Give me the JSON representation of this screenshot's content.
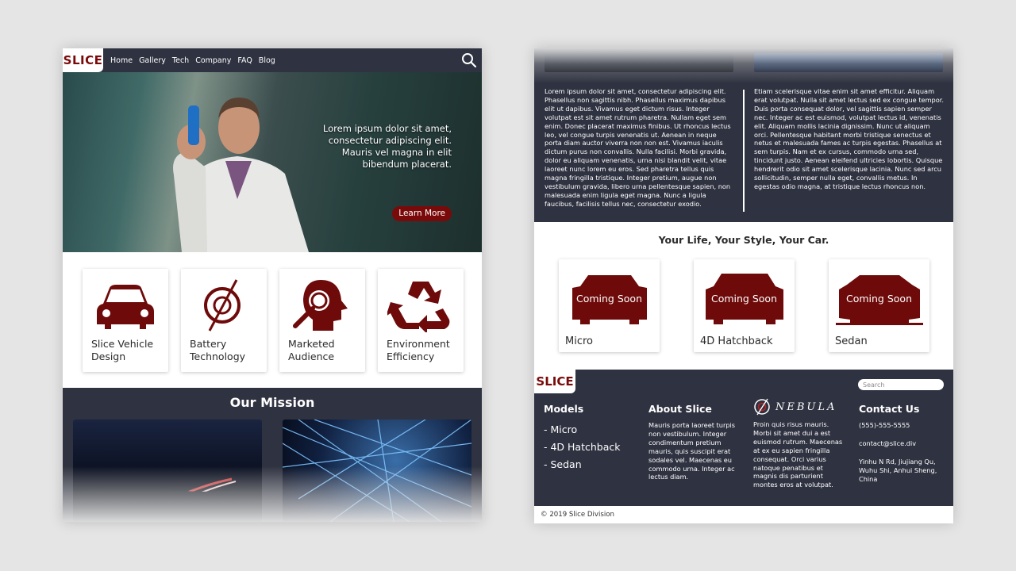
{
  "left": {
    "brand": "SLICE",
    "nav": [
      "Home",
      "Gallery",
      "Tech",
      "Company",
      "FAQ",
      "Blog"
    ],
    "hero": {
      "text": "Lorem ipsum dolor sit amet, consectetur adipiscing elit. Mauris vel magna in elit bibendum placerat.",
      "button": "Learn More"
    },
    "features": [
      {
        "label": "Slice Vehicle Design",
        "icon": "car-icon"
      },
      {
        "label": "Battery Technology",
        "icon": "battery-icon"
      },
      {
        "label": "Marketed Audience",
        "icon": "audience-icon"
      },
      {
        "label": "Environment Efficiency",
        "icon": "recycle-icon"
      }
    ],
    "mission_title": "Our Mission"
  },
  "right": {
    "para_left": "Lorem ipsum dolor sit amet, consectetur adipiscing elit. Phasellus non sagittis nibh. Phasellus maximus dapibus elit ut dapibus. Vivamus eget dictum risus. Integer volutpat est sit amet rutrum pharetra. Nullam eget sem enim. Donec placerat maximus finibus. Ut rhoncus lectus leo, vel congue turpis venenatis ut. Aenean in neque porta diam auctor viverra non non est. Vivamus iaculis dictum purus non convallis. Nulla facilisi. Morbi gravida, dolor eu aliquam venenatis, urna nisi blandit velit, vitae laoreet nunc lorem eu eros. Sed pharetra tellus quis magna fringilla tristique. Integer pretium, augue non vestibulum gravida, libero urna pellentesque sapien, non malesuada enim ligula eget magna. Nunc a ligula faucibus, facilisis tellus nec, consectetur exodio.",
    "para_right": "Etiam scelerisque vitae enim sit amet efficitur. Aliquam erat volutpat. Nulla sit amet lectus sed ex congue tempor. Duis porta consequat dolor, vel sagittis sapien semper nec. Integer ac est euismod, volutpat lectus id, venenatis elit. Aliquam mollis lacinia dignissim. Nunc ut aliquam orci. Pellentesque habitant morbi tristique senectus et netus et malesuada fames ac turpis egestas. Phasellus at sem turpis. Nam et ex cursus, commodo urna sed, tincidunt justo. Aenean eleifend ultricies lobortis. Quisque hendrerit odio sit amet scelerisque lacinia. Nunc sed arcu sollicitudin, semper nulla eget, convallis metus. In egestas odio magna, at tristique lectus rhoncus non.",
    "tagline": "Your Life, Your Style, Your Car.",
    "models": [
      {
        "name": "Micro",
        "badge": "Coming Soon"
      },
      {
        "name": "4D Hatchback",
        "badge": "Coming Soon"
      },
      {
        "name": "Sedan",
        "badge": "Coming Soon"
      }
    ],
    "footer": {
      "brand": "SLICE",
      "search_placeholder": "Search",
      "models_title": "Models",
      "models_list": [
        "- Micro",
        "- 4D Hatchback",
        "- Sedan"
      ],
      "about_title": "About Slice",
      "about_text": "Mauris porta laoreet turpis non vestibulum. Integer condimentum pretium mauris, quis suscipit erat sodales vel. Maecenas eu commodo urna. Integer ac lectus diam.",
      "nebula_word": "NEBULA",
      "nebula_text": "Proin quis risus mauris. Morbi sit amet dui a est euismod rutrum. Maecenas at ex eu sapien fringilla consequat. Orci varius natoque penatibus et magnis dis parturient montes eros at volutpat.",
      "contact_title": "Contact Us",
      "phone": "(555)-555-5555",
      "email": "contact@slice.div",
      "address": "Yinhu N Rd, Jiujiang Qu, Wuhu Shi, Anhui Sheng, China"
    },
    "copyright": "© 2019 Slice Division"
  },
  "colors": {
    "brand_red": "#7a0a0a",
    "dark_bg": "#2f3240",
    "page_bg": "#e5e5e5"
  }
}
